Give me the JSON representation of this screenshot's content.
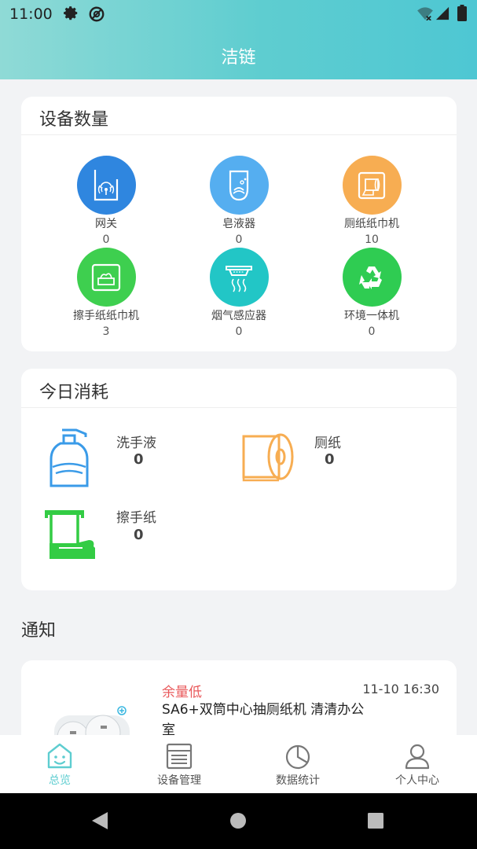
{
  "status_bar": {
    "time": "11:00"
  },
  "header": {
    "title": "洁链"
  },
  "device_count": {
    "title": "设备数量",
    "items": [
      {
        "name": "网关",
        "count": "0",
        "color": "#2f86df",
        "icon": "gateway-icon"
      },
      {
        "name": "皂液器",
        "count": "0",
        "color": "#55aef0",
        "icon": "soap-dispenser-icon"
      },
      {
        "name": "厕纸纸巾机",
        "count": "10",
        "color": "#f7ad52",
        "icon": "toilet-paper-machine-icon"
      },
      {
        "name": "擦手纸纸巾机",
        "count": "3",
        "color": "#3ecf4f",
        "icon": "tissue-box-icon"
      },
      {
        "name": "烟气感应器",
        "count": "0",
        "color": "#22c6c6",
        "icon": "smoke-sensor-icon"
      },
      {
        "name": "环境一体机",
        "count": "0",
        "color": "#2fcc52",
        "icon": "recycle-icon"
      }
    ]
  },
  "consumption": {
    "title": "今日消耗",
    "items": [
      {
        "label": "洗手液",
        "value": "0",
        "icon": "hand-soap-icon",
        "color": "#3a9be8"
      },
      {
        "label": "厕纸",
        "value": "0",
        "icon": "toilet-roll-icon",
        "color": "#f7ad52"
      },
      {
        "label": "擦手纸",
        "value": "0",
        "icon": "hand-towel-icon",
        "color": "#33cc44"
      }
    ]
  },
  "notice": {
    "title": "通知",
    "items": [
      {
        "status": "余量低",
        "time": "11-10 16:30",
        "text": "SA6+双筒中心抽厕纸机 清清办公室"
      }
    ]
  },
  "tabbar": {
    "items": [
      {
        "label": "总览",
        "icon": "overview-icon",
        "active": true
      },
      {
        "label": "设备管理",
        "icon": "device-management-icon",
        "active": false
      },
      {
        "label": "数据统计",
        "icon": "statistics-icon",
        "active": false
      },
      {
        "label": "个人中心",
        "icon": "profile-icon",
        "active": false
      }
    ]
  },
  "colors": {
    "accent": "#5ecdd0",
    "alert": "#e9595b"
  }
}
